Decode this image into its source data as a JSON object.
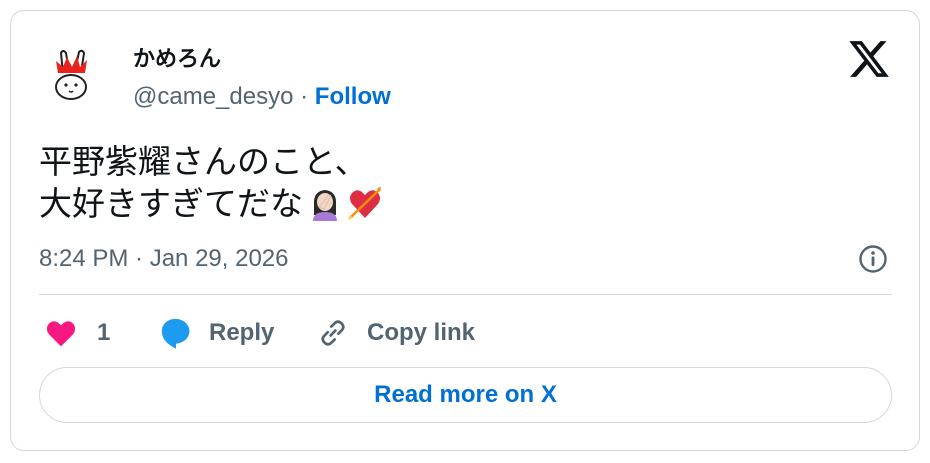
{
  "tweet": {
    "author_name": "かめろん",
    "author_handle": "@came_desyo",
    "separator": "·",
    "follow_label": "Follow",
    "text_line1": "平野紫耀さんのこと、",
    "text_line2": "大好きすぎてだな",
    "emojis": [
      "face-palm-woman-emoji",
      "heart-with-arrow-emoji"
    ],
    "timestamp": "8:24 PM · Jan 29, 2026"
  },
  "actions": {
    "like_count": "1",
    "reply_label": "Reply",
    "copy_link_label": "Copy link"
  },
  "read_more_label": "Read more on X",
  "colors": {
    "accent": "#006fd6",
    "like": "#f91880",
    "reply": "#1d9bf0",
    "secondary_text": "#536471",
    "border": "#cfd9de"
  }
}
